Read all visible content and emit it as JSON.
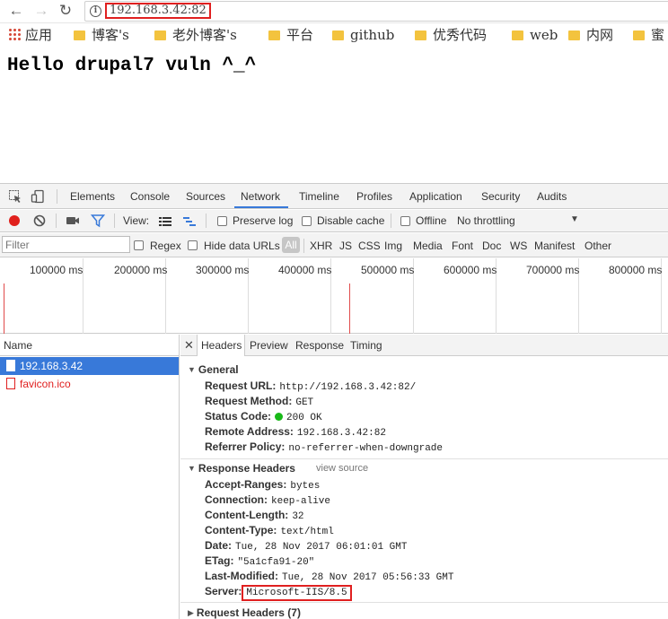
{
  "browser": {
    "url": "192.168.3.42:82",
    "bookmarks": [
      {
        "label": "应用",
        "type": "apps"
      },
      {
        "label": "博客's",
        "type": "folder"
      },
      {
        "label": "老外博客's",
        "type": "folder"
      },
      {
        "label": "平台",
        "type": "folder"
      },
      {
        "label": "github",
        "type": "folder"
      },
      {
        "label": "优秀代码",
        "type": "folder"
      },
      {
        "label": "web",
        "type": "folder"
      },
      {
        "label": "内网",
        "type": "folder"
      },
      {
        "label": "蜜",
        "type": "folder"
      }
    ]
  },
  "page": {
    "heading": "Hello drupal7 vuln ^_^"
  },
  "devtools": {
    "tabs": [
      "Elements",
      "Console",
      "Sources",
      "Network",
      "Timeline",
      "Profiles",
      "Application",
      "Security",
      "Audits"
    ],
    "active_tab": "Network",
    "toolbar": {
      "view_label": "View:",
      "preserve_log": "Preserve log",
      "disable_cache": "Disable cache",
      "offline": "Offline",
      "throttling": "No throttling"
    },
    "filter": {
      "placeholder": "Filter",
      "regex": "Regex",
      "hide_data_urls": "Hide data URLs",
      "all": "All",
      "types": [
        "XHR",
        "JS",
        "CSS",
        "Img",
        "Media",
        "Font",
        "Doc",
        "WS",
        "Manifest",
        "Other"
      ]
    },
    "timeline_labels": [
      "100000 ms",
      "200000 ms",
      "300000 ms",
      "400000 ms",
      "500000 ms",
      "600000 ms",
      "700000 ms",
      "800000 ms"
    ],
    "requests": {
      "header": "Name",
      "rows": [
        {
          "name": "192.168.3.42",
          "state": "selected"
        },
        {
          "name": "favicon.ico",
          "state": "error"
        }
      ]
    },
    "detail_tabs": [
      "Headers",
      "Preview",
      "Response",
      "Timing"
    ],
    "general": {
      "title": "General",
      "request_url_k": "Request URL:",
      "request_url_v": "http://192.168.3.42:82/",
      "request_method_k": "Request Method:",
      "request_method_v": "GET",
      "status_code_k": "Status Code:",
      "status_code_v": "200 OK",
      "remote_address_k": "Remote Address:",
      "remote_address_v": "192.168.3.42:82",
      "referrer_policy_k": "Referrer Policy:",
      "referrer_policy_v": "no-referrer-when-downgrade"
    },
    "response_headers": {
      "title": "Response Headers",
      "view_source": "view source",
      "accept_ranges_k": "Accept-Ranges:",
      "accept_ranges_v": "bytes",
      "connection_k": "Connection:",
      "connection_v": "keep-alive",
      "content_length_k": "Content-Length:",
      "content_length_v": "32",
      "content_type_k": "Content-Type:",
      "content_type_v": "text/html",
      "date_k": "Date:",
      "date_v": "Tue, 28 Nov 2017 06:01:01 GMT",
      "etag_k": "ETag:",
      "etag_v": "\"5a1cfa91-20\"",
      "last_modified_k": "Last-Modified:",
      "last_modified_v": "Tue, 28 Nov 2017 05:56:33 GMT",
      "server_k": "Server:",
      "server_v": "Microsoft-IIS/8.5"
    },
    "request_headers": {
      "title": "Request Headers (7)"
    }
  }
}
